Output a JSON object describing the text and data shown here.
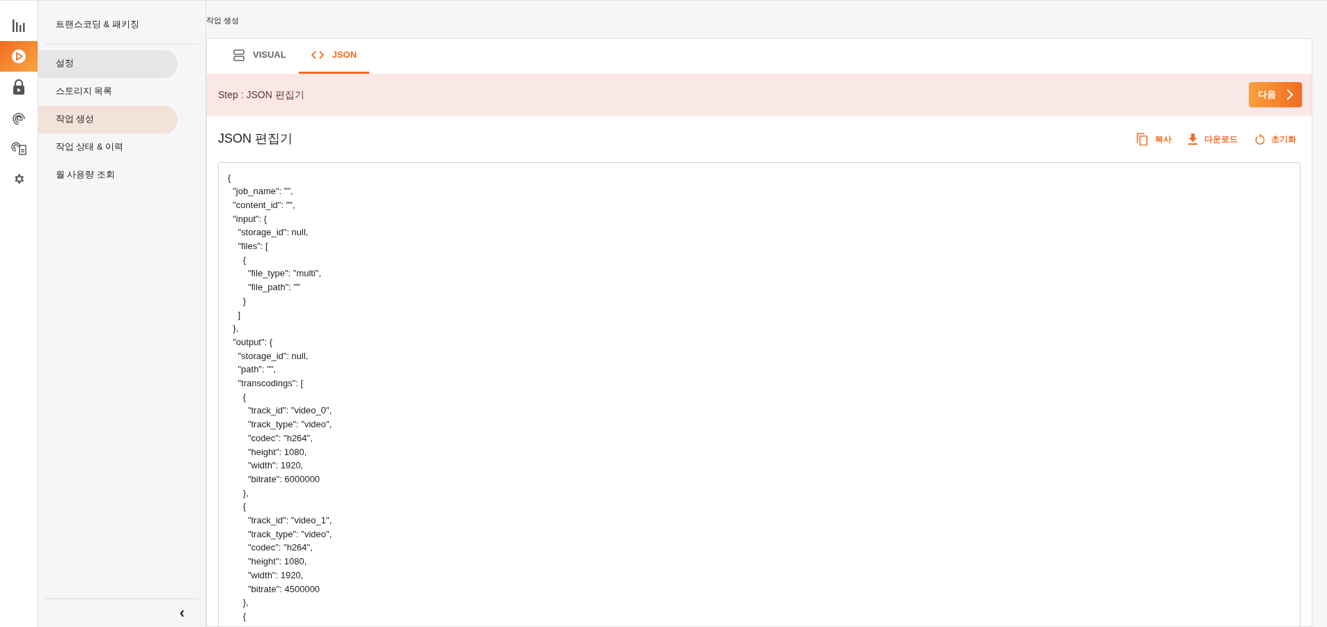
{
  "rail": [
    {
      "kind": "chart",
      "selected": false
    },
    {
      "kind": "play",
      "selected": true
    },
    {
      "kind": "lock",
      "selected": false
    },
    {
      "kind": "fingerprint",
      "selected": false
    },
    {
      "kind": "fingerprint-card",
      "selected": false
    },
    {
      "kind": "gear",
      "selected": false
    }
  ],
  "sidebar": {
    "title": "트랜스코딩 & 패키징",
    "items": [
      {
        "label": "설정",
        "selected": false,
        "hovered": true
      },
      {
        "label": "스토리지 목록",
        "selected": false,
        "hovered": false
      },
      {
        "label": "작업 생성",
        "selected": true,
        "hovered": false
      },
      {
        "label": "작업 상태 & 이력",
        "selected": false,
        "hovered": false
      },
      {
        "label": "월 사용량 조회",
        "selected": false,
        "hovered": false
      }
    ],
    "collapse": "‹"
  },
  "breadcrumb": "작업 생성",
  "tabs": [
    {
      "kind": "visual",
      "label": "VISUAL",
      "selected": false
    },
    {
      "kind": "code",
      "label": "JSON",
      "selected": true
    }
  ],
  "step": {
    "label": "Step : JSON 편집기",
    "next_button": "다음"
  },
  "editor": {
    "title": "JSON 편집기",
    "actions": [
      {
        "kind": "copy",
        "label": "복사"
      },
      {
        "kind": "download",
        "label": "다운로드"
      },
      {
        "kind": "reset",
        "label": "초기화"
      }
    ],
    "lines": [
      "{",
      "  \"job_name\": \"\",",
      "  \"content_id\": \"\",",
      "  \"input\": {",
      "    \"storage_id\": null,",
      "    \"files\": [",
      "      {",
      "        \"file_type\": \"multi\",",
      "        \"file_path\": \"\"",
      "      }",
      "    ]",
      "  },",
      "  \"output\": {",
      "    \"storage_id\": null,",
      "    \"path\": \"\",",
      "    \"transcodings\": [",
      "      {",
      "        \"track_id\": \"video_0\",",
      "        \"track_type\": \"video\",",
      "        \"codec\": \"h264\",",
      "        \"height\": 1080,",
      "        \"width\": 1920,",
      "        \"bitrate\": 6000000",
      "      },",
      "      {",
      "        \"track_id\": \"video_1\",",
      "        \"track_type\": \"video\",",
      "        \"codec\": \"h264\",",
      "        \"height\": 1080,",
      "        \"width\": 1920,",
      "        \"bitrate\": 4500000",
      "      },",
      "      {"
    ]
  }
}
